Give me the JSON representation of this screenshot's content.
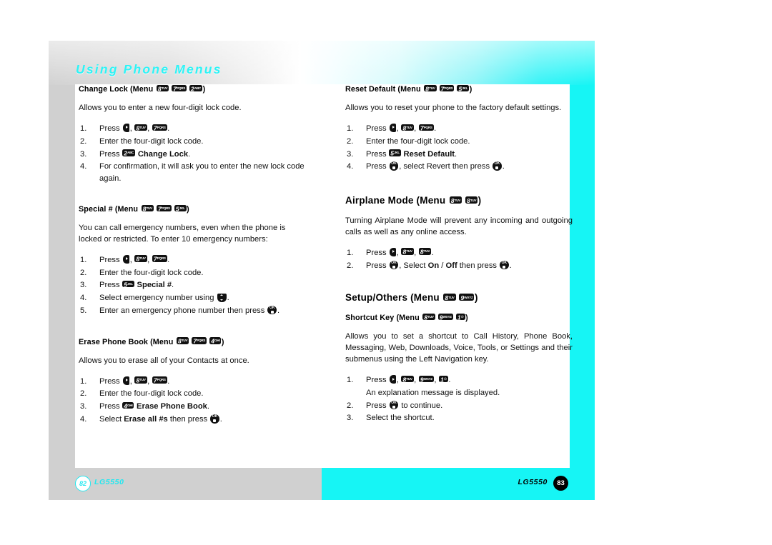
{
  "chapter": {
    "title": "Using Phone Menus"
  },
  "footer": {
    "left_page": "82",
    "left_brand": "LG5550",
    "right_page": "83",
    "right_brand": "LG5550"
  },
  "colors": {
    "accent_cyan": "#16f5f5",
    "title_cyan": "#2ef3f6",
    "page_grey": "#d0d0d0",
    "key_black": "#111111"
  },
  "keys": {
    "menu": "menu-send-key",
    "ok": "ok-key",
    "nav": "up-down-navigation-key",
    "k1": {
      "digit": "1",
      "letters": "☉"
    },
    "k2": {
      "digit": "2",
      "letters": "ABC"
    },
    "k4": {
      "digit": "4",
      "letters": "GHI"
    },
    "k5": {
      "digit": "5",
      "letters": "JKL"
    },
    "k7": {
      "digit": "7",
      "letters": "PQRS"
    },
    "k8": {
      "digit": "8",
      "letters": "TUV"
    },
    "k9": {
      "digit": "9",
      "letters": "WXYZ"
    }
  },
  "left_column": {
    "sections": [
      {
        "id": "change-lock",
        "heading_prefix": "Change Lock (Menu",
        "heading_suffix": ")",
        "body": "Allows you to enter a new four-digit lock code.",
        "steps": [
          {
            "prefix": "Press",
            "suffix": "."
          },
          {
            "text": "Enter the four-digit lock code."
          },
          {
            "prefix": "Press",
            "bold": "Change Lock",
            "suffix": "."
          },
          {
            "text": "For confirmation, it will ask you to enter the new lock code again."
          }
        ]
      },
      {
        "id": "special-number",
        "heading_prefix": "Special # (Menu",
        "heading_suffix": ")",
        "body": "You can call emergency numbers, even when the phone is locked or restricted. To enter 10 emergency numbers:",
        "steps": [
          {
            "prefix": "Press",
            "suffix": "."
          },
          {
            "text": "Enter the four-digit lock code."
          },
          {
            "prefix": "Press",
            "bold": "Special #",
            "suffix": "."
          },
          {
            "prefix": "Select emergency number using",
            "suffix": "."
          },
          {
            "prefix": "Enter an emergency phone number then press",
            "suffix": "."
          }
        ]
      },
      {
        "id": "erase-phone-book",
        "heading_prefix": "Erase Phone Book (Menu",
        "heading_suffix": ")",
        "body": "Allows you to erase all of your Contacts at once.",
        "steps": [
          {
            "prefix": "Press",
            "suffix": "."
          },
          {
            "text": "Enter the four-digit lock code."
          },
          {
            "prefix": "Press",
            "bold": "Erase Phone Book",
            "suffix": "."
          },
          {
            "prefix": "Select",
            "bold": "Erase all #s",
            "mid": "then press",
            "suffix": "."
          }
        ]
      }
    ]
  },
  "right_column": {
    "sections": [
      {
        "id": "reset-default",
        "heading_prefix": "Reset Default (Menu",
        "heading_suffix": ")",
        "body": "Allows you to reset your phone to the factory default settings.",
        "steps": [
          {
            "prefix": "Press",
            "suffix": "."
          },
          {
            "text": "Enter the four-digit lock code."
          },
          {
            "prefix": "Press",
            "bold": "Reset Default",
            "suffix": "."
          },
          {
            "prefix": "Press",
            "mid": ", select Revert then press",
            "suffix": "."
          }
        ]
      },
      {
        "id": "airplane-mode",
        "heading_prefix": "Airplane Mode (Menu",
        "heading_suffix": ")",
        "body": "Turning Airplane Mode will prevent any incoming and outgoing calls as well as any online access.",
        "steps": [
          {
            "prefix": "Press",
            "suffix": "."
          },
          {
            "prefix": "Press",
            "mid_a": ", Select",
            "bold_a": "On",
            "slash": "/",
            "bold_b": "Off",
            "mid_b": "then press",
            "suffix": "."
          }
        ]
      },
      {
        "id": "setup-others",
        "heading_prefix": "Setup/Others (Menu",
        "heading_suffix": ")",
        "sub_heading_prefix": "Shortcut Key (Menu",
        "sub_heading_suffix": ")",
        "body": "Allows you to set a shortcut to Call History, Phone Book, Messaging, Web, Downloads, Voice, Tools, or Settings and their submenus using the Left Navigation key.",
        "steps": [
          {
            "prefix": "Press",
            "suffix": "."
          },
          {
            "note": "An explanation message is displayed."
          },
          {
            "prefix": "Press",
            "mid": "to continue."
          },
          {
            "text": "Select the shortcut."
          }
        ]
      }
    ]
  }
}
